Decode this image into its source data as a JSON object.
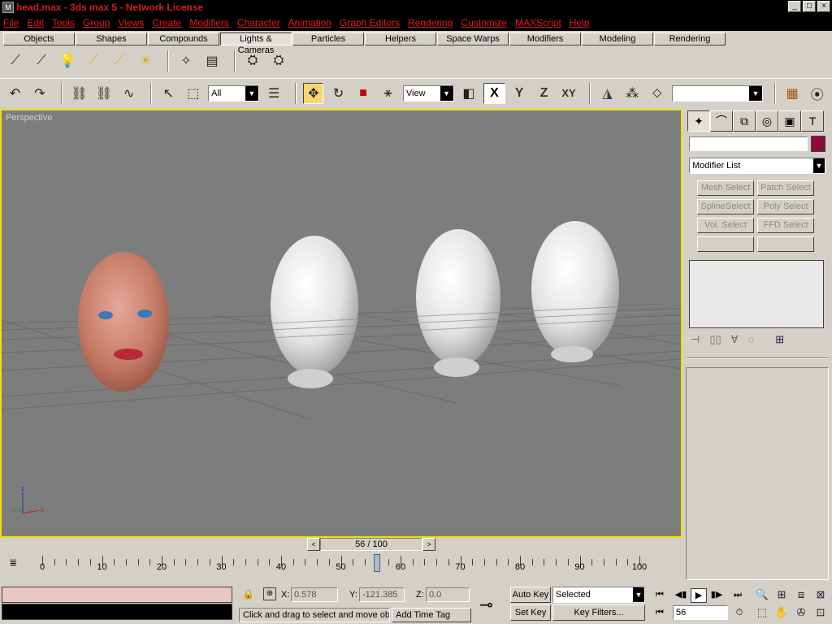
{
  "window": {
    "title": "head.max - 3ds max 5 - Network License",
    "app_icon": "3ds-max-icon",
    "buttons": [
      "_",
      "□",
      "×"
    ]
  },
  "menu": [
    "File",
    "Edit",
    "Tools",
    "Group",
    "Views",
    "Create",
    "Modifiers",
    "Character",
    "Animation",
    "Graph Editors",
    "Rendering",
    "Customize",
    "MAXScript",
    "Help"
  ],
  "tabs": [
    {
      "label": "Objects",
      "active": false
    },
    {
      "label": "Shapes",
      "active": false
    },
    {
      "label": "Compounds",
      "active": false
    },
    {
      "label": "Lights & Cameras",
      "active": true
    },
    {
      "label": "Particles",
      "active": false
    },
    {
      "label": "Helpers",
      "active": false
    },
    {
      "label": "Space Warps",
      "active": false
    },
    {
      "label": "Modifiers",
      "active": false
    },
    {
      "label": "Modeling",
      "active": false
    },
    {
      "label": "Rendering",
      "active": false
    }
  ],
  "main_toolbar": {
    "selection_filter": "All",
    "reference_coord": "View",
    "axes": [
      "X",
      "Y",
      "Z",
      "XY"
    ],
    "named_selection": ""
  },
  "viewport": {
    "label": "Perspective",
    "axis_labels": {
      "x": "x",
      "y": "y",
      "z": "z"
    },
    "colors": {
      "background": "#7d7d7d",
      "border": "#f2e000",
      "grid": "#6a6a6a"
    }
  },
  "command_panel": {
    "object_name": "",
    "object_color": "#8b0a3a",
    "modifier_list": "Modifier List",
    "modifier_buttons": [
      "Mesh Select",
      "Patch Select",
      "SplineSelect",
      "Poly Select",
      "Vol. Select",
      "FFD Select",
      "",
      ""
    ]
  },
  "time_slider": {
    "label": "56 / 100",
    "current": 56,
    "total": 100,
    "prev": "<",
    "next": ">"
  },
  "track_bar": {
    "labels": [
      "0",
      "10",
      "20",
      "30",
      "40",
      "50",
      "60",
      "70",
      "80",
      "90",
      "100"
    ]
  },
  "status": {
    "x_label": "X:",
    "x_value": "0.578",
    "y_label": "Y:",
    "y_value": "-121.385",
    "z_label": "Z:",
    "z_value": "0.0",
    "prompt": "Click and drag to select and move obj",
    "add_time_tag": "Add Time Tag",
    "auto_key": "Auto Key",
    "set_key": "Set Key",
    "key_mode": "Selected",
    "key_filters": "Key Filters...",
    "current_frame": "56"
  }
}
